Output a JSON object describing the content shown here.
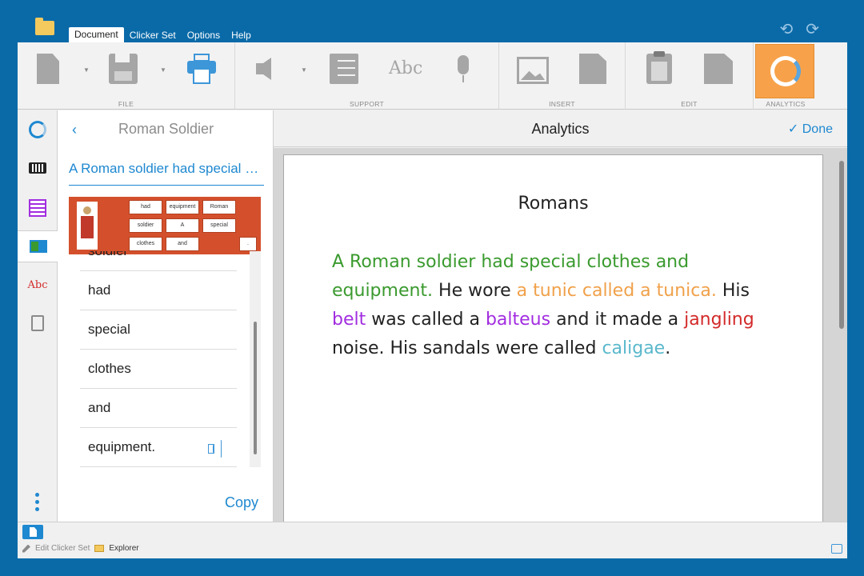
{
  "menu": {
    "tabs": [
      "Document",
      "Clicker Set",
      "Options",
      "Help"
    ],
    "active_tab": "Document",
    "undo": "⟲",
    "redo": "⟳"
  },
  "ribbon": {
    "groups": {
      "file": "FILE",
      "support": "SUPPORT",
      "insert": "INSERT",
      "edit": "EDIT",
      "analytics": "ANALYTICS"
    },
    "abc_icon_text": "Abc"
  },
  "panel": {
    "back_icon": "‹",
    "title": "Roman Soldier",
    "sentence": "A Roman soldier had special clothes and equipment.",
    "clicker_cells": [
      "had",
      "equipment",
      "Roman",
      "soldier",
      "A",
      "special",
      "clothes",
      "and",
      "."
    ],
    "words": [
      "soldier",
      "had",
      "special",
      "clothes",
      "and",
      "equipment."
    ],
    "copy_label": "Copy"
  },
  "main": {
    "title": "Analytics",
    "done_label": "✓ Done"
  },
  "document": {
    "title": "Romans",
    "segments": [
      {
        "text": "A Roman soldier had special clothes and equipment.",
        "color": "green"
      },
      {
        "text": " He wore ",
        "color": "black"
      },
      {
        "text": "a tunic called a tunica.",
        "color": "orange"
      },
      {
        "text": " His ",
        "color": "black"
      },
      {
        "text": "belt",
        "color": "purple"
      },
      {
        "text": " was called a ",
        "color": "black"
      },
      {
        "text": "balteus",
        "color": "purple"
      },
      {
        "text": " and it made a ",
        "color": "black"
      },
      {
        "text": "jangling",
        "color": "red"
      },
      {
        "text": " noise. His sandals were called ",
        "color": "black"
      },
      {
        "text": "caligae",
        "color": "teal"
      },
      {
        "text": ".",
        "color": "black"
      }
    ]
  },
  "status": {
    "edit_label": "Edit Clicker Set",
    "explorer_label": "Explorer"
  },
  "colors": {
    "accent": "#1e88d0",
    "analytics_active": "#f7a24a",
    "window_frame": "#0a6aa8"
  }
}
